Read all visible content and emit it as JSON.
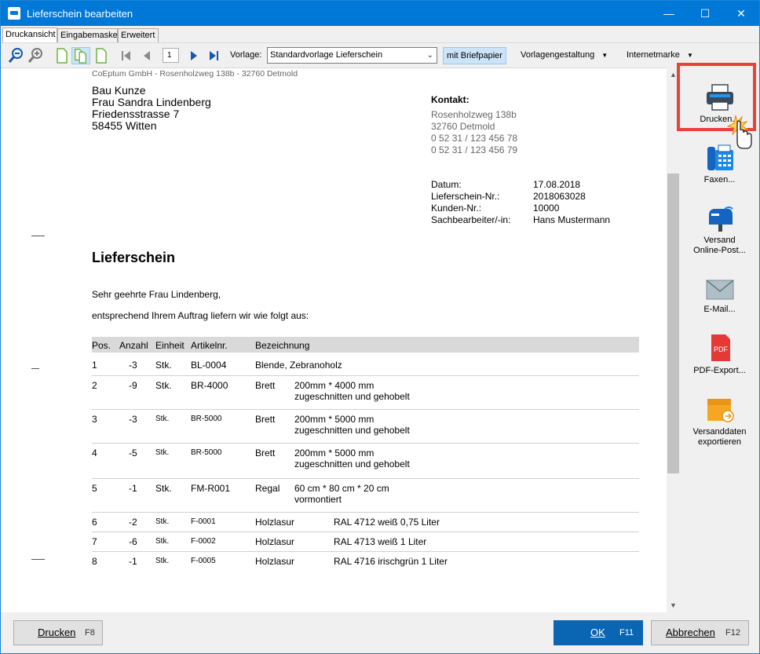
{
  "window": {
    "title": "Lieferschein bearbeiten"
  },
  "tabs": [
    "Druckansicht",
    "Eingabemaske",
    "Erweitert"
  ],
  "toolbar": {
    "page_number": "1",
    "vorlage_label": "Vorlage:",
    "vorlage_value": "Standardvorlage Lieferschein",
    "briefpapier_label": "mit Briefpapier",
    "vorlagengestaltung_label": "Vorlagengestaltung",
    "internetmarke_label": "Internetmarke"
  },
  "document": {
    "sender_line": "CoEptum GmbH - Rosenholzweg 138b - 32760 Detmold",
    "recipient": [
      "Bau Kunze",
      "Frau Sandra Lindenberg",
      "Friedensstrasse 7",
      "58455 Witten"
    ],
    "contact_title": "Kontakt:",
    "contact_lines": [
      "Rosenholzweg 138b",
      "32760 Detmold",
      "0 52 31 / 123 456 78",
      "0 52 31 / 123 456 79"
    ],
    "meta": [
      {
        "label": "Datum:",
        "value": "17.08.2018"
      },
      {
        "label": "Lieferschein-Nr.:",
        "value": "2018063028"
      },
      {
        "label": "Kunden-Nr.:",
        "value": "10000"
      },
      {
        "label": "Sachbearbeiter/-in:",
        "value": "Hans Mustermann"
      }
    ],
    "heading": "Lieferschein",
    "salutation": "Sehr geehrte Frau Lindenberg,",
    "intro": "entsprechend Ihrem Auftrag liefern wir wie folgt aus:",
    "columns": [
      "Pos.",
      "Anzahl",
      "Einheit",
      "Artikelnr.",
      "Bezeichnung"
    ],
    "rows": [
      {
        "pos": "1",
        "anzahl": "-3",
        "einheit": "Stk.",
        "artikel": "BL-0004",
        "bez": "Blende, Zebranoholz",
        "detail": [
          "",
          ""
        ]
      },
      {
        "pos": "2",
        "anzahl": "-9",
        "einheit": "Stk.",
        "artikel": "BR-4000",
        "bez": "Brett",
        "detail": [
          "200mm * 4000 mm",
          "zugeschnitten und gehobelt"
        ]
      },
      {
        "pos": "3",
        "anzahl": "-3",
        "einheit": "Stk.",
        "artikel": "BR-5000",
        "bez": "Brett",
        "detail": [
          "200mm * 5000 mm",
          "zugeschnitten und gehobelt"
        ]
      },
      {
        "pos": "4",
        "anzahl": "-5",
        "einheit": "Stk.",
        "artikel": "BR-5000",
        "bez": "Brett",
        "detail": [
          "200mm * 5000 mm",
          "zugeschnitten und gehobelt"
        ]
      },
      {
        "pos": "5",
        "anzahl": "-1",
        "einheit": "Stk.",
        "artikel": "FM-R001",
        "bez": "Regal",
        "detail": [
          "60 cm * 80 cm * 20 cm",
          "vormontiert"
        ]
      },
      {
        "pos": "6",
        "anzahl": "-2",
        "einheit": "Stk.",
        "artikel": "F-0001",
        "bez": "Holzlasur",
        "detail": [
          "RAL 4712 weiß 0,75 Liter",
          ""
        ]
      },
      {
        "pos": "7",
        "anzahl": "-6",
        "einheit": "Stk.",
        "artikel": "F-0002",
        "bez": "Holzlasur",
        "detail": [
          "RAL 4713 weiß 1 Liter",
          ""
        ]
      },
      {
        "pos": "8",
        "anzahl": "-1",
        "einheit": "Stk.",
        "artikel": "F-0005",
        "bez": "Holzlasur",
        "detail": [
          "RAL 4716 irischgrün 1 Liter",
          ""
        ]
      }
    ]
  },
  "actions": {
    "print": "Drucken...",
    "fax": "Faxen...",
    "online_post": [
      "Versand",
      "Online-Post..."
    ],
    "email": "E-Mail...",
    "pdf": "PDF-Export...",
    "pdf_icon_text": "PDF",
    "versanddaten": [
      "Versanddaten",
      "exportieren"
    ]
  },
  "footer": {
    "drucken_label": "Drucken",
    "drucken_key": "F8",
    "ok_label": "OK",
    "ok_key": "F11",
    "abbrechen_label": "Abbrechen",
    "abbrechen_key": "F12"
  },
  "colors": {
    "titlebar": "#0078d7",
    "highlight": "#e8423b",
    "primary_button": "#0a65b2"
  }
}
